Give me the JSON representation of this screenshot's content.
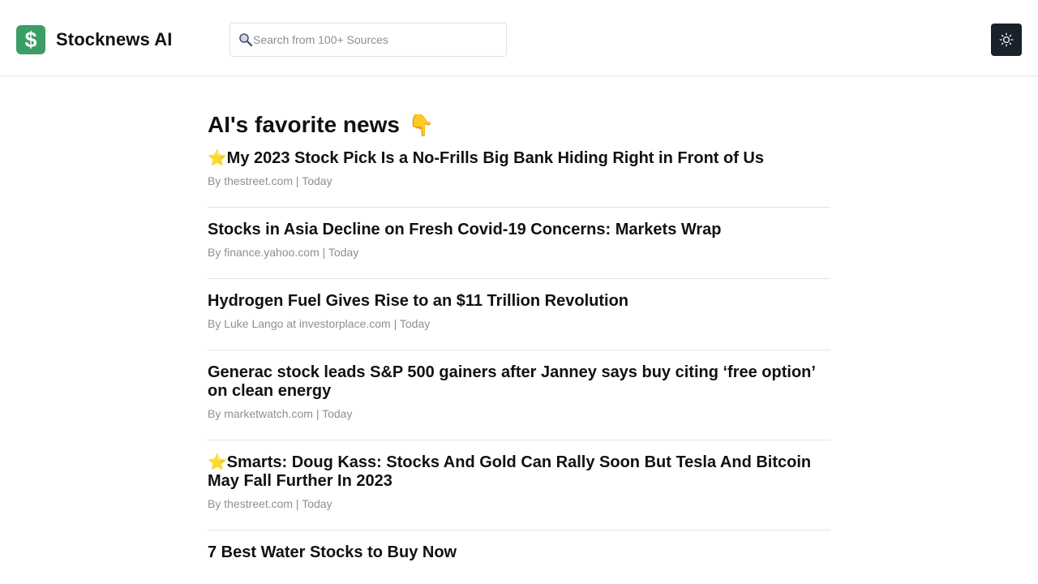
{
  "header": {
    "logo_symbol": "$",
    "app_title": "Stocknews AI",
    "search_placeholder": "Search from 100+ Sources",
    "theme_toggle_icon": "sun-icon"
  },
  "main": {
    "section_title": "AI's favorite news",
    "section_emoji": "👇",
    "news": [
      {
        "starred": true,
        "title": "My 2023 Stock Pick Is a No-Frills Big Bank Hiding Right in Front of Us",
        "meta": "By thestreet.com | Today"
      },
      {
        "starred": false,
        "title": "Stocks in Asia Decline on Fresh Covid-19 Concerns: Markets Wrap",
        "meta": "By finance.yahoo.com | Today"
      },
      {
        "starred": false,
        "title": "Hydrogen Fuel Gives Rise to an $11 Trillion Revolution",
        "meta": "By Luke Lango at investorplace.com | Today"
      },
      {
        "starred": false,
        "title": "Generac stock leads S&P 500 gainers after Janney says buy citing ‘free option’ on clean energy",
        "meta": "By marketwatch.com | Today"
      },
      {
        "starred": true,
        "title": "Smarts: Doug Kass: Stocks And Gold Can Rally Soon But Tesla And Bitcoin May Fall Further In 2023",
        "meta": "By thestreet.com | Today"
      },
      {
        "starred": false,
        "title": "7 Best Water Stocks to Buy Now",
        "meta": ""
      }
    ],
    "star_emoji": "⭐"
  },
  "colors": {
    "brand_green": "#3b9e63",
    "theme_button_bg": "#1a202c",
    "meta_text": "#8b8f96",
    "divider": "#e2e4e8"
  }
}
